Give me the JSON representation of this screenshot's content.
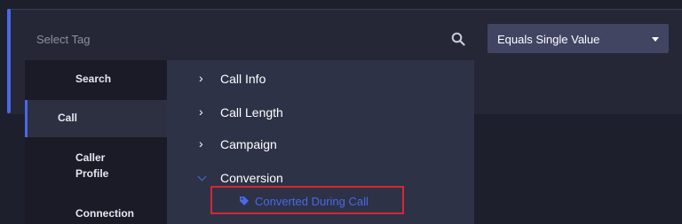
{
  "filter": {
    "tag_placeholder": "Select Tag",
    "operator_value": "Equals Single Value"
  },
  "categories": [
    {
      "label": "Search"
    },
    {
      "label": "Call",
      "active": true
    },
    {
      "label": "Caller Profile",
      "line1": "Caller",
      "line2": "Profile"
    },
    {
      "label": "Connection"
    }
  ],
  "subcategories": [
    {
      "label": "Call Info",
      "expanded": false
    },
    {
      "label": "Call Length",
      "expanded": false
    },
    {
      "label": "Campaign",
      "expanded": false
    },
    {
      "label": "Conversion",
      "expanded": true
    }
  ],
  "selected_tag": {
    "label": "Converted During Call",
    "icon": "tag-icon",
    "highlight_color": "#d9262e"
  },
  "colors": {
    "accent": "#4a68e8",
    "background": "#1e1f2c",
    "panel": "#252736"
  },
  "icons": {
    "search": "search-icon",
    "dropdown": "chevron-down-icon",
    "collapsed": "chevron-right-icon",
    "expanded": "chevron-down-icon"
  }
}
